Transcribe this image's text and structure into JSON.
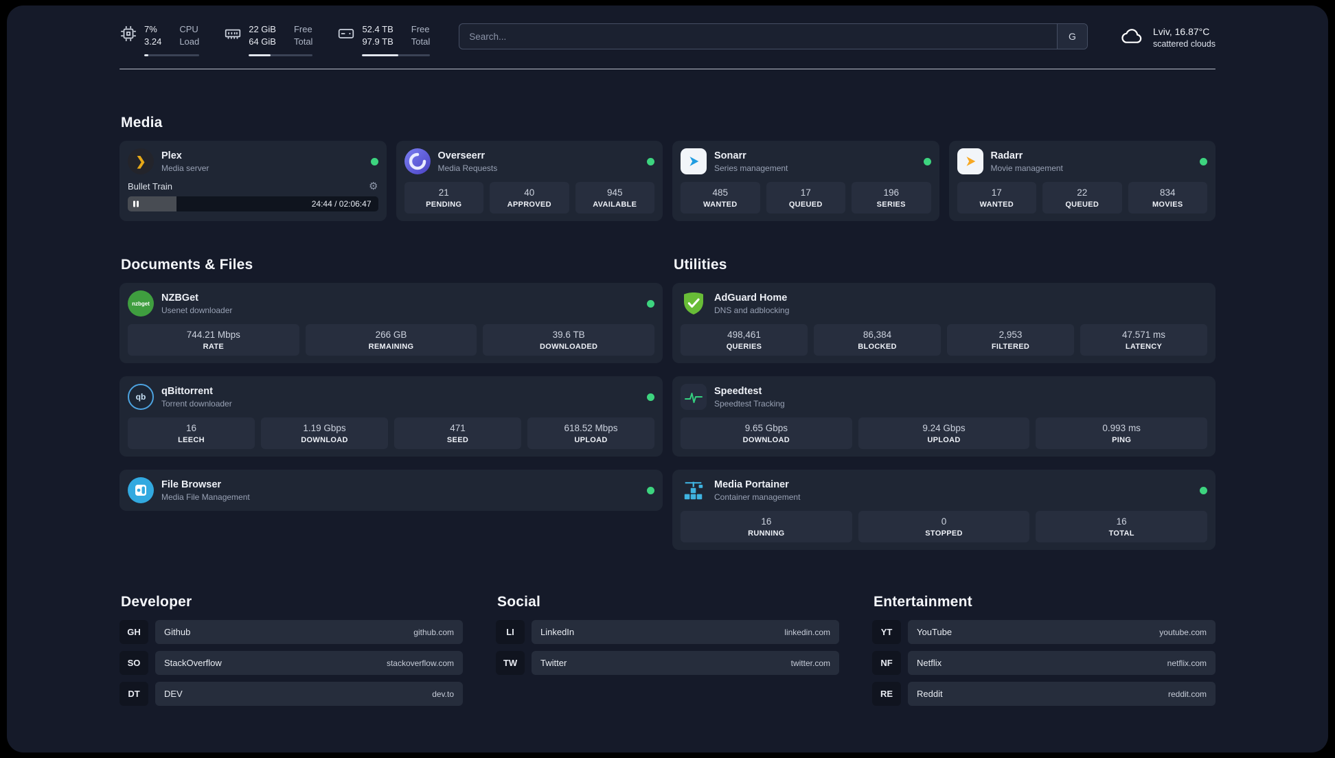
{
  "topbar": {
    "cpu": {
      "value1": "7%",
      "value2": "3.24",
      "label1": "CPU",
      "label2": "Load",
      "bar_percent": 7
    },
    "ram": {
      "value1": "22 GiB",
      "value2": "64 GiB",
      "label1": "Free",
      "label2": "Total",
      "bar_percent": 34
    },
    "disk": {
      "value1": "52.4 TB",
      "value2": "97.9 TB",
      "label1": "Free",
      "label2": "Total",
      "bar_percent": 53
    },
    "search": {
      "placeholder": "Search...",
      "button_label": "G"
    },
    "weather": {
      "location": "Lviv, 16.87°C",
      "condition": "scattered clouds"
    }
  },
  "icons": {
    "gear": "⚙",
    "plex_chevron": "❯"
  },
  "colors": {
    "status_online": "#3dd47f",
    "plex_gold": "#e6a817",
    "sonarr_blue": "#1f9ce0",
    "radarr_orange": "#f7a823",
    "adguard_green": "#68bc37",
    "overseerr_purple": "#5a55d6",
    "nzbget_green": "#3f9e3f",
    "qbittorrent_blue": "#4da3e0",
    "filebrowser_blue": "#32a9e0",
    "portainer_blue": "#3fb3e0",
    "speedtest_green": "#35d07f"
  },
  "media": {
    "heading": "Media",
    "plex": {
      "name": "Plex",
      "desc": "Media server",
      "now_playing": "Bullet Train",
      "time": "24:44 / 02:06:47",
      "progress_percent": 19.5
    },
    "cards": [
      {
        "name": "Overseerr",
        "desc": "Media Requests",
        "stats": [
          {
            "value": "21",
            "label": "PENDING"
          },
          {
            "value": "40",
            "label": "APPROVED"
          },
          {
            "value": "945",
            "label": "AVAILABLE"
          }
        ]
      },
      {
        "name": "Sonarr",
        "desc": "Series management",
        "stats": [
          {
            "value": "485",
            "label": "WANTED"
          },
          {
            "value": "17",
            "label": "QUEUED"
          },
          {
            "value": "196",
            "label": "SERIES"
          }
        ]
      },
      {
        "name": "Radarr",
        "desc": "Movie management",
        "stats": [
          {
            "value": "17",
            "label": "WANTED"
          },
          {
            "value": "22",
            "label": "QUEUED"
          },
          {
            "value": "834",
            "label": "MOVIES"
          }
        ]
      }
    ]
  },
  "documents": {
    "heading": "Documents & Files",
    "nzbget": {
      "name": "NZBGet",
      "desc": "Usenet downloader",
      "icon_text": "nzbget",
      "stats": [
        {
          "value": "744.21 Mbps",
          "label": "RATE"
        },
        {
          "value": "266 GB",
          "label": "REMAINING"
        },
        {
          "value": "39.6 TB",
          "label": "DOWNLOADED"
        }
      ]
    },
    "qbittorrent": {
      "name": "qBittorrent",
      "desc": "Torrent downloader",
      "icon_text": "qb",
      "stats": [
        {
          "value": "16",
          "label": "LEECH"
        },
        {
          "value": "1.19 Gbps",
          "label": "DOWNLOAD"
        },
        {
          "value": "471",
          "label": "SEED"
        },
        {
          "value": "618.52 Mbps",
          "label": "UPLOAD"
        }
      ]
    },
    "filebrowser": {
      "name": "File Browser",
      "desc": "Media File Management"
    }
  },
  "utilities": {
    "heading": "Utilities",
    "adguard": {
      "name": "AdGuard Home",
      "desc": "DNS and adblocking",
      "stats": [
        {
          "value": "498,461",
          "label": "QUERIES"
        },
        {
          "value": "86,384",
          "label": "BLOCKED"
        },
        {
          "value": "2,953",
          "label": "FILTERED"
        },
        {
          "value": "47.571 ms",
          "label": "LATENCY"
        }
      ]
    },
    "speedtest": {
      "name": "Speedtest",
      "desc": "Speedtest Tracking",
      "stats": [
        {
          "value": "9.65 Gbps",
          "label": "DOWNLOAD"
        },
        {
          "value": "9.24 Gbps",
          "label": "UPLOAD"
        },
        {
          "value": "0.993 ms",
          "label": "PING"
        }
      ]
    },
    "portainer": {
      "name": "Media Portainer",
      "desc": "Container management",
      "stats": [
        {
          "value": "16",
          "label": "RUNNING"
        },
        {
          "value": "0",
          "label": "STOPPED"
        },
        {
          "value": "16",
          "label": "TOTAL"
        }
      ]
    }
  },
  "bookmarks": {
    "groups": [
      {
        "heading": "Developer",
        "items": [
          {
            "abbr": "GH",
            "name": "Github",
            "domain": "github.com"
          },
          {
            "abbr": "SO",
            "name": "StackOverflow",
            "domain": "stackoverflow.com"
          },
          {
            "abbr": "DT",
            "name": "DEV",
            "domain": "dev.to"
          }
        ]
      },
      {
        "heading": "Social",
        "items": [
          {
            "abbr": "LI",
            "name": "LinkedIn",
            "domain": "linkedin.com"
          },
          {
            "abbr": "TW",
            "name": "Twitter",
            "domain": "twitter.com"
          }
        ]
      },
      {
        "heading": "Entertainment",
        "items": [
          {
            "abbr": "YT",
            "name": "YouTube",
            "domain": "youtube.com"
          },
          {
            "abbr": "NF",
            "name": "Netflix",
            "domain": "netflix.com"
          },
          {
            "abbr": "RE",
            "name": "Reddit",
            "domain": "reddit.com"
          }
        ]
      }
    ]
  }
}
